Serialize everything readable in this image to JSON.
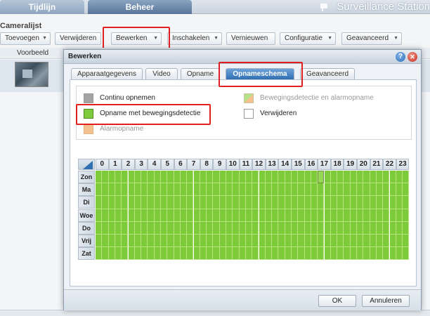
{
  "top_tabs": [
    "Tijdlijn",
    "Beheer"
  ],
  "brand": "Surveillance Station",
  "subtitle": "Cameralijst",
  "toolbar": {
    "add": "Toevoegen",
    "delete": "Verwijderen",
    "edit": "Bewerken",
    "enable": "Inschakelen",
    "refresh": "Vernieuwen",
    "config": "Configuratie",
    "advanced": "Geavanceerd"
  },
  "list": {
    "preview_header": "Voorbeeld"
  },
  "dialog": {
    "title": "Bewerken",
    "tabs": [
      "Apparaatgegevens",
      "Video",
      "Opname",
      "Opnameschema",
      "Geavanceerd"
    ],
    "active_tab": "Opnameschema",
    "legend": {
      "continuous": "Continu opnemen",
      "motion": "Opname met bewegingsdetectie",
      "alarm": "Alarmopname",
      "motion_alarm": "Bewegingsdetectie en alarmopname",
      "remove": "Verwijderen"
    },
    "legend_colors": {
      "continuous": "#a3a3a3",
      "motion": "#7dcb3a",
      "alarm": "#f3c08e",
      "motion_alarm": "#f0c994",
      "remove": "#ffffff"
    },
    "hours": [
      "0",
      "1",
      "2",
      "3",
      "4",
      "5",
      "6",
      "7",
      "8",
      "9",
      "10",
      "11",
      "12",
      "13",
      "14",
      "15",
      "16",
      "17",
      "18",
      "19",
      "20",
      "21",
      "22",
      "23"
    ],
    "days": [
      "Zon",
      "Ma",
      "Di",
      "Woe",
      "Do",
      "Vrij",
      "Zat"
    ],
    "ok": "OK",
    "cancel": "Annuleren"
  }
}
